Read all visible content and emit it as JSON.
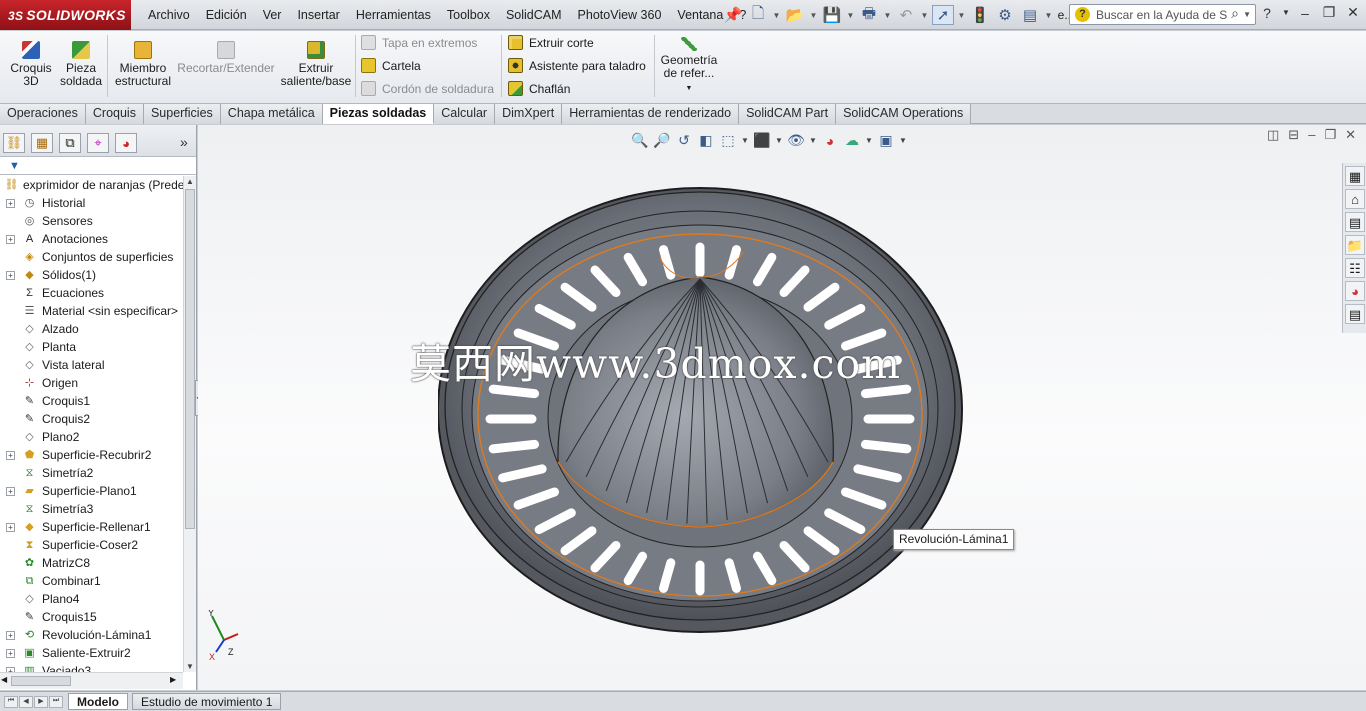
{
  "app": {
    "brand": "SOLIDWORKS",
    "brand_prefix": "3S"
  },
  "menus": [
    "Archivo",
    "Edición",
    "Ver",
    "Insertar",
    "Herramientas",
    "Toolbox",
    "SolidCAM",
    "PhotoView 360",
    "Ventana",
    "?"
  ],
  "top_icons": [
    "pushpin-icon",
    "new-document-icon",
    "open-folder-icon",
    "save-icon",
    "print-icon",
    "undo-icon",
    "select-arrow-icon",
    "traffic-light-icon",
    "options-icon",
    "file-properties-icon"
  ],
  "search": {
    "placeholder": "Buscar en la Ayuda de S",
    "overflow_label": "e..."
  },
  "ribbon": {
    "croquis3d": "Croquis 3D",
    "pieza_soldada": "Pieza soldada",
    "miembro_estructural": "Miembro estructural",
    "recortar_extender": "Recortar/Extender",
    "extruir_saliente": "Extruir saliente/base",
    "tapa_extremos": "Tapa en extremos",
    "cartela": "Cartela",
    "cordon_soldadura": "Cordón de soldadura",
    "extruir_corte": "Extruir corte",
    "asistente_taladro": "Asistente para taladro",
    "chaflan": "Chaflán",
    "geometria_referencia": "Geometría de refer..."
  },
  "tabs": [
    {
      "label": "Operaciones",
      "active": false
    },
    {
      "label": "Croquis",
      "active": false
    },
    {
      "label": "Superficies",
      "active": false
    },
    {
      "label": "Chapa metálica",
      "active": false
    },
    {
      "label": "Piezas soldadas",
      "active": true
    },
    {
      "label": "Calcular",
      "active": false
    },
    {
      "label": "DimXpert",
      "active": false
    },
    {
      "label": "Herramientas de renderizado",
      "active": false
    },
    {
      "label": "SolidCAM Part",
      "active": false
    },
    {
      "label": "SolidCAM Operations",
      "active": false
    }
  ],
  "panel_tabs": [
    "featuremanager-icon",
    "propertymanager-icon",
    "configurationmanager-icon",
    "dimxpert-manager-icon",
    "display-manager-icon"
  ],
  "tree": {
    "root": "exprimidor de naranjas  (Prede",
    "items": [
      {
        "label": "Historial",
        "icon": "history-icon",
        "expandable": true
      },
      {
        "label": "Sensores",
        "icon": "sensors-icon",
        "expandable": false
      },
      {
        "label": "Anotaciones",
        "icon": "annotations-icon",
        "expandable": true
      },
      {
        "label": "Conjuntos de superficies",
        "icon": "surface-bodies-icon",
        "expandable": false
      },
      {
        "label": "Sólidos(1)",
        "icon": "solid-bodies-icon",
        "expandable": true
      },
      {
        "label": "Ecuaciones",
        "icon": "equations-icon",
        "expandable": false
      },
      {
        "label": "Material <sin especificar>",
        "icon": "material-icon",
        "expandable": false
      },
      {
        "label": "Alzado",
        "icon": "plane-icon",
        "expandable": false
      },
      {
        "label": "Planta",
        "icon": "plane-icon",
        "expandable": false
      },
      {
        "label": "Vista lateral",
        "icon": "plane-icon",
        "expandable": false
      },
      {
        "label": "Origen",
        "icon": "origin-icon",
        "expandable": false
      },
      {
        "label": "Croquis1",
        "icon": "sketch-icon",
        "expandable": false
      },
      {
        "label": "Croquis2",
        "icon": "sketch-icon",
        "expandable": false
      },
      {
        "label": "Plano2",
        "icon": "plane-icon",
        "expandable": false
      },
      {
        "label": "Superficie-Recubrir2",
        "icon": "loft-surface-icon",
        "expandable": true
      },
      {
        "label": "Simetría2",
        "icon": "mirror-icon",
        "expandable": false
      },
      {
        "label": "Superficie-Plano1",
        "icon": "planar-surface-icon",
        "expandable": true
      },
      {
        "label": "Simetría3",
        "icon": "mirror-icon",
        "expandable": false
      },
      {
        "label": "Superficie-Rellenar1",
        "icon": "fill-surface-icon",
        "expandable": true
      },
      {
        "label": "Superficie-Coser2",
        "icon": "knit-surface-icon",
        "expandable": false
      },
      {
        "label": "MatrizC8",
        "icon": "circular-pattern-icon",
        "expandable": false
      },
      {
        "label": "Combinar1",
        "icon": "combine-icon",
        "expandable": false
      },
      {
        "label": "Plano4",
        "icon": "plane-icon",
        "expandable": false
      },
      {
        "label": "Croquis15",
        "icon": "sketch-icon",
        "expandable": false
      },
      {
        "label": "Revolución-Lámina1",
        "icon": "revolve-thin-icon",
        "expandable": true
      },
      {
        "label": "Saliente-Extruir2",
        "icon": "extrude-boss-icon",
        "expandable": true
      },
      {
        "label": "Vaciado3",
        "icon": "shell-icon",
        "expandable": true
      }
    ]
  },
  "viewport": {
    "watermark": "莫西网www.3dmox.com",
    "tooltip": "Revolución-Lámina1",
    "triad": {
      "x": "X",
      "y": "Y",
      "z": "Z"
    }
  },
  "bottom_tabs": [
    {
      "label": "Modelo",
      "active": true
    },
    {
      "label": "Estudio de movimiento 1",
      "active": false
    }
  ],
  "colors": {
    "brand_red": "#b31b20",
    "model_gray": "#6d7078",
    "highlight_orange": "#e07a1c",
    "viewport_bg": "#f4f5f7"
  }
}
